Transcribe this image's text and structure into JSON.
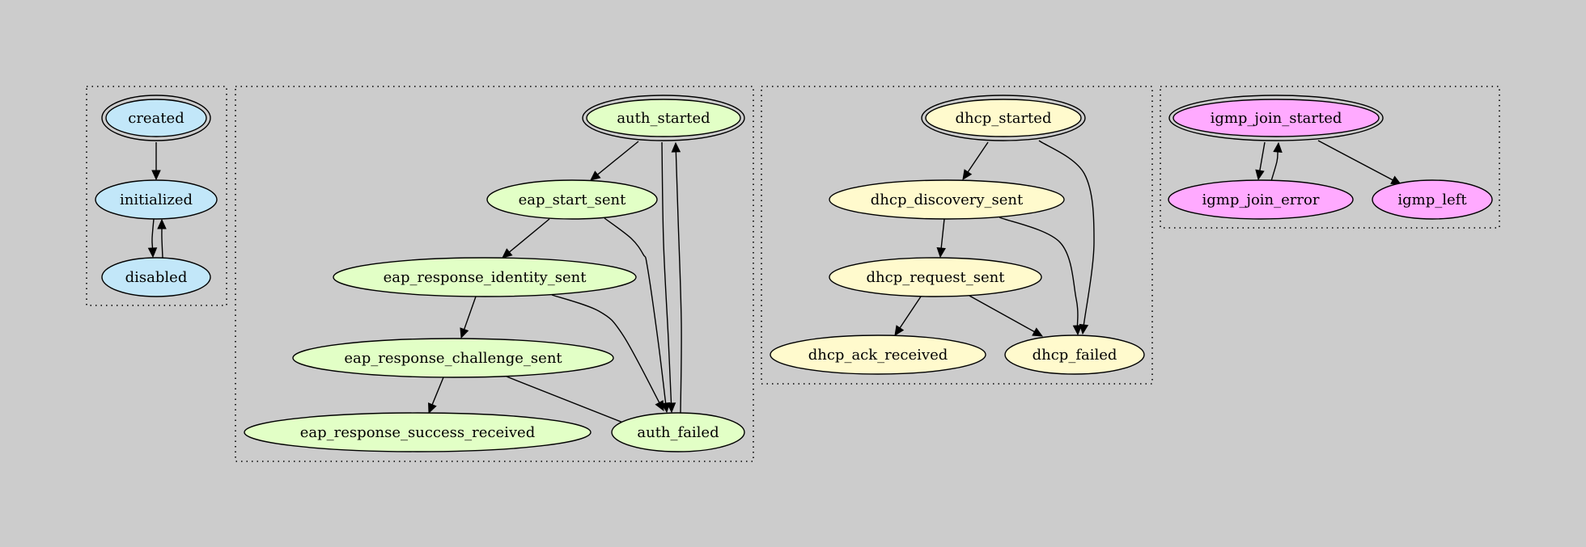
{
  "diagram": {
    "type": "state-machine",
    "background": "#cccccc",
    "clusters": [
      {
        "id": "device",
        "fill": "#c2e7f9",
        "nodes": [
          {
            "id": "created",
            "label": "created",
            "initial": true
          },
          {
            "id": "initialized",
            "label": "initialized",
            "initial": false
          },
          {
            "id": "disabled",
            "label": "disabled",
            "initial": false
          }
        ]
      },
      {
        "id": "auth",
        "fill": "#e2ffc6",
        "nodes": [
          {
            "id": "auth_started",
            "label": "auth_started",
            "initial": true
          },
          {
            "id": "eap_start_sent",
            "label": "eap_start_sent",
            "initial": false
          },
          {
            "id": "eap_response_identity_sent",
            "label": "eap_response_identity_sent",
            "initial": false
          },
          {
            "id": "eap_response_challenge_sent",
            "label": "eap_response_challenge_sent",
            "initial": false
          },
          {
            "id": "eap_response_success_received",
            "label": "eap_response_success_received",
            "initial": false
          },
          {
            "id": "auth_failed",
            "label": "auth_failed",
            "initial": false
          }
        ]
      },
      {
        "id": "dhcp",
        "fill": "#fffacd",
        "nodes": [
          {
            "id": "dhcp_started",
            "label": "dhcp_started",
            "initial": true
          },
          {
            "id": "dhcp_discovery_sent",
            "label": "dhcp_discovery_sent",
            "initial": false
          },
          {
            "id": "dhcp_request_sent",
            "label": "dhcp_request_sent",
            "initial": false
          },
          {
            "id": "dhcp_ack_received",
            "label": "dhcp_ack_received",
            "initial": false
          },
          {
            "id": "dhcp_failed",
            "label": "dhcp_failed",
            "initial": false
          }
        ]
      },
      {
        "id": "igmp",
        "fill": "#ffaaff",
        "nodes": [
          {
            "id": "igmp_join_started",
            "label": "igmp_join_started",
            "initial": true
          },
          {
            "id": "igmp_join_error",
            "label": "igmp_join_error",
            "initial": false
          },
          {
            "id": "igmp_left",
            "label": "igmp_left",
            "initial": false
          }
        ]
      }
    ],
    "edges": [
      {
        "from": "created",
        "to": "initialized"
      },
      {
        "from": "initialized",
        "to": "disabled"
      },
      {
        "from": "disabled",
        "to": "initialized"
      },
      {
        "from": "auth_started",
        "to": "eap_start_sent"
      },
      {
        "from": "auth_started",
        "to": "auth_failed"
      },
      {
        "from": "auth_failed",
        "to": "auth_started"
      },
      {
        "from": "eap_start_sent",
        "to": "eap_response_identity_sent"
      },
      {
        "from": "eap_start_sent",
        "to": "auth_failed"
      },
      {
        "from": "eap_response_identity_sent",
        "to": "eap_response_challenge_sent"
      },
      {
        "from": "eap_response_identity_sent",
        "to": "auth_failed"
      },
      {
        "from": "eap_response_challenge_sent",
        "to": "eap_response_success_received"
      },
      {
        "from": "eap_response_challenge_sent",
        "to": "auth_failed"
      },
      {
        "from": "dhcp_started",
        "to": "dhcp_discovery_sent"
      },
      {
        "from": "dhcp_started",
        "to": "dhcp_failed"
      },
      {
        "from": "dhcp_discovery_sent",
        "to": "dhcp_request_sent"
      },
      {
        "from": "dhcp_discovery_sent",
        "to": "dhcp_failed"
      },
      {
        "from": "dhcp_request_sent",
        "to": "dhcp_ack_received"
      },
      {
        "from": "dhcp_request_sent",
        "to": "dhcp_failed"
      },
      {
        "from": "igmp_join_started",
        "to": "igmp_join_error"
      },
      {
        "from": "igmp_join_error",
        "to": "igmp_join_started"
      },
      {
        "from": "igmp_join_started",
        "to": "igmp_left"
      }
    ]
  }
}
